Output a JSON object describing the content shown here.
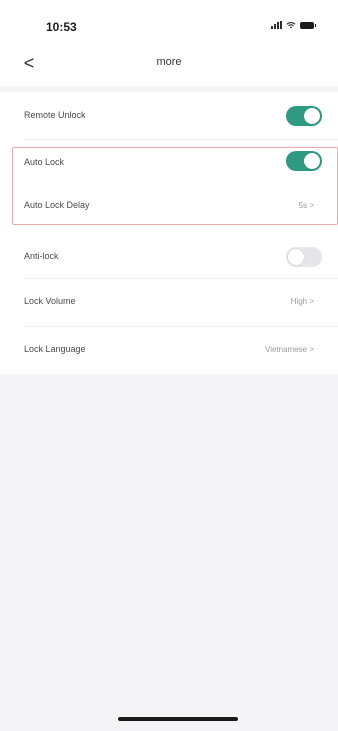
{
  "status_bar": {
    "time": "10:53"
  },
  "header": {
    "back_glyph": "<",
    "title": "more"
  },
  "settings": {
    "remote_unlock": {
      "label": "Remote Unlock",
      "enabled": true
    },
    "auto_lock": {
      "label": "Auto Lock",
      "enabled": true
    },
    "auto_lock_delay": {
      "label": "Auto Lock Delay",
      "value": "5s >"
    },
    "anti_lock": {
      "label": "Anti-lock",
      "enabled": false
    },
    "lock_volume": {
      "label": "Lock Volume",
      "value": "High >"
    },
    "lock_language": {
      "label": "Lock Language",
      "value": "Vietnamese >"
    }
  },
  "colors": {
    "toggle_on": "#2e9a82",
    "toggle_off": "#e6e6ea",
    "highlight_border": "#e9a9ad",
    "background": "#f4f4f6"
  },
  "icons": {
    "back": "chevron-left-icon",
    "signal": "cellular-signal-icon",
    "wifi": "wifi-icon",
    "battery": "battery-icon"
  }
}
